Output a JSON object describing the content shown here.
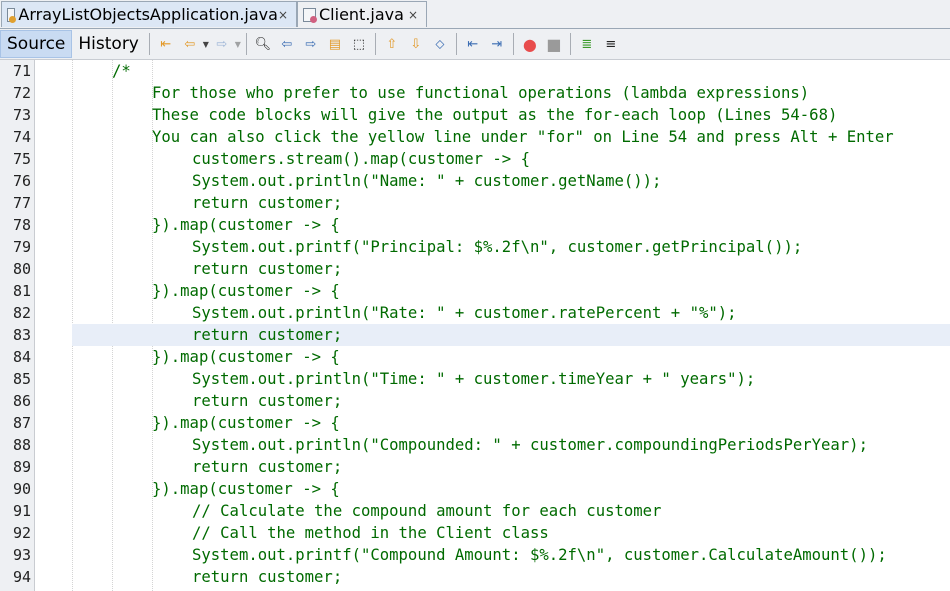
{
  "tabs": [
    {
      "label": "ArrayListObjectsApplication.java",
      "active": true,
      "icon": "java-file-icon",
      "close": "×"
    },
    {
      "label": "Client.java",
      "active": false,
      "icon": "java-file-icon",
      "close": "×"
    }
  ],
  "toolbar": {
    "source_label": "Source",
    "history_label": "History",
    "icons": [
      "last-edit-icon",
      "back-icon",
      "forward-icon",
      "find-icon",
      "find-previous-icon",
      "find-next-icon",
      "toggle-highlight-icon",
      "toggle-rect-selection-icon",
      "previous-bookmark-icon",
      "next-bookmark-icon",
      "toggle-bookmark-icon",
      "shift-left-icon",
      "shift-right-icon",
      "start-macro-icon",
      "stop-macro-icon",
      "comment-icon",
      "uncomment-icon"
    ]
  },
  "editor": {
    "highlighted_line": 83,
    "lines": [
      {
        "n": "71",
        "text": "/*",
        "indent": 10
      },
      {
        "n": "72",
        "text": "For those who prefer to use functional operations (lambda expressions)",
        "indent": 14
      },
      {
        "n": "73",
        "text": "These code blocks will give the output as the for-each loop (Lines 54-68)",
        "indent": 14
      },
      {
        "n": "74",
        "text": "You can also click the yellow line under \"for\" on Line 54 and press Alt + Enter",
        "indent": 14
      },
      {
        "n": "75",
        "text": "customers.stream().map(customer -> {",
        "indent": 18
      },
      {
        "n": "76",
        "text": "System.out.println(\"Name: \" + customer.getName());",
        "indent": 18
      },
      {
        "n": "77",
        "text": "return customer;",
        "indent": 18
      },
      {
        "n": "78",
        "text": "}).map(customer -> {",
        "indent": 14
      },
      {
        "n": "79",
        "text": "System.out.printf(\"Principal: $%.2f\\n\", customer.getPrincipal());",
        "indent": 18
      },
      {
        "n": "80",
        "text": "return customer;",
        "indent": 18
      },
      {
        "n": "81",
        "text": "}).map(customer -> {",
        "indent": 14
      },
      {
        "n": "82",
        "text": "System.out.println(\"Rate: \" + customer.ratePercent + \"%\");",
        "indent": 18
      },
      {
        "n": "83",
        "text": "return customer;",
        "indent": 18
      },
      {
        "n": "84",
        "text": "}).map(customer -> {",
        "indent": 14
      },
      {
        "n": "85",
        "text": "System.out.println(\"Time: \" + customer.timeYear + \" years\");",
        "indent": 18
      },
      {
        "n": "86",
        "text": "return customer;",
        "indent": 18
      },
      {
        "n": "87",
        "text": "}).map(customer -> {",
        "indent": 14
      },
      {
        "n": "88",
        "text": "System.out.println(\"Compounded: \" + customer.compoundingPeriodsPerYear);",
        "indent": 18
      },
      {
        "n": "89",
        "text": "return customer;",
        "indent": 18
      },
      {
        "n": "90",
        "text": "}).map(customer -> {",
        "indent": 14
      },
      {
        "n": "91",
        "text": "// Calculate the compound amount for each customer",
        "indent": 18
      },
      {
        "n": "92",
        "text": "// Call the method in the Client class",
        "indent": 18
      },
      {
        "n": "93",
        "text": "System.out.printf(\"Compound Amount: $%.2f\\n\", customer.CalculateAmount());",
        "indent": 18
      },
      {
        "n": "94",
        "text": "return customer;",
        "indent": 18
      }
    ]
  },
  "colors": {
    "code_text": "#006a00",
    "highlight_line": "#e8eef8",
    "active_tab": "#dce7f5"
  }
}
